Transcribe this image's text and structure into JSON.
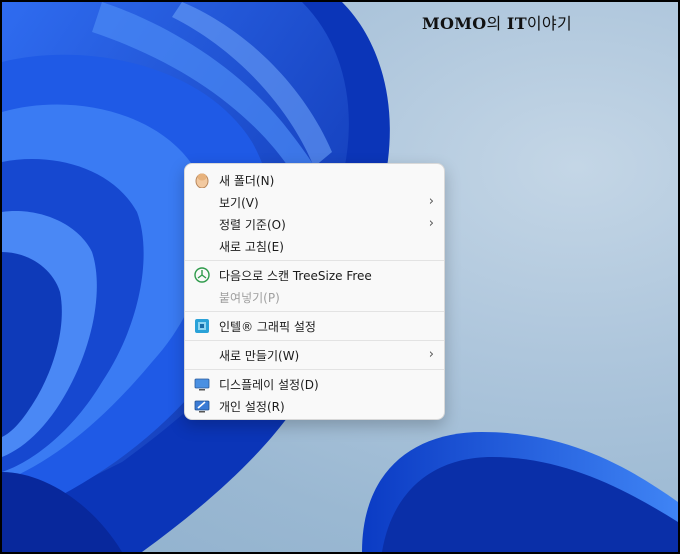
{
  "watermark": {
    "part1": "MOMO",
    "part2": "의 ",
    "part3": "IT",
    "part4": "이야기"
  },
  "menu": {
    "new_folder": "새 폴더(N)",
    "view": "보기(V)",
    "sort_by": "정렬 기준(O)",
    "refresh": "새로 고침(E)",
    "scan_treesize": "다음으로 스캔 TreeSize Free",
    "paste": "붙여넣기(P)",
    "intel_graphics": "인텔® 그래픽 설정",
    "new": "새로 만들기(W)",
    "display_settings": "디스플레이 설정(D)",
    "personalize": "개인 설정(R)"
  },
  "colors": {
    "menu_bg": "#f9f9f9",
    "wallpaper_blue": "#1a4fd6",
    "desktop_sky": "#aec6dc"
  }
}
